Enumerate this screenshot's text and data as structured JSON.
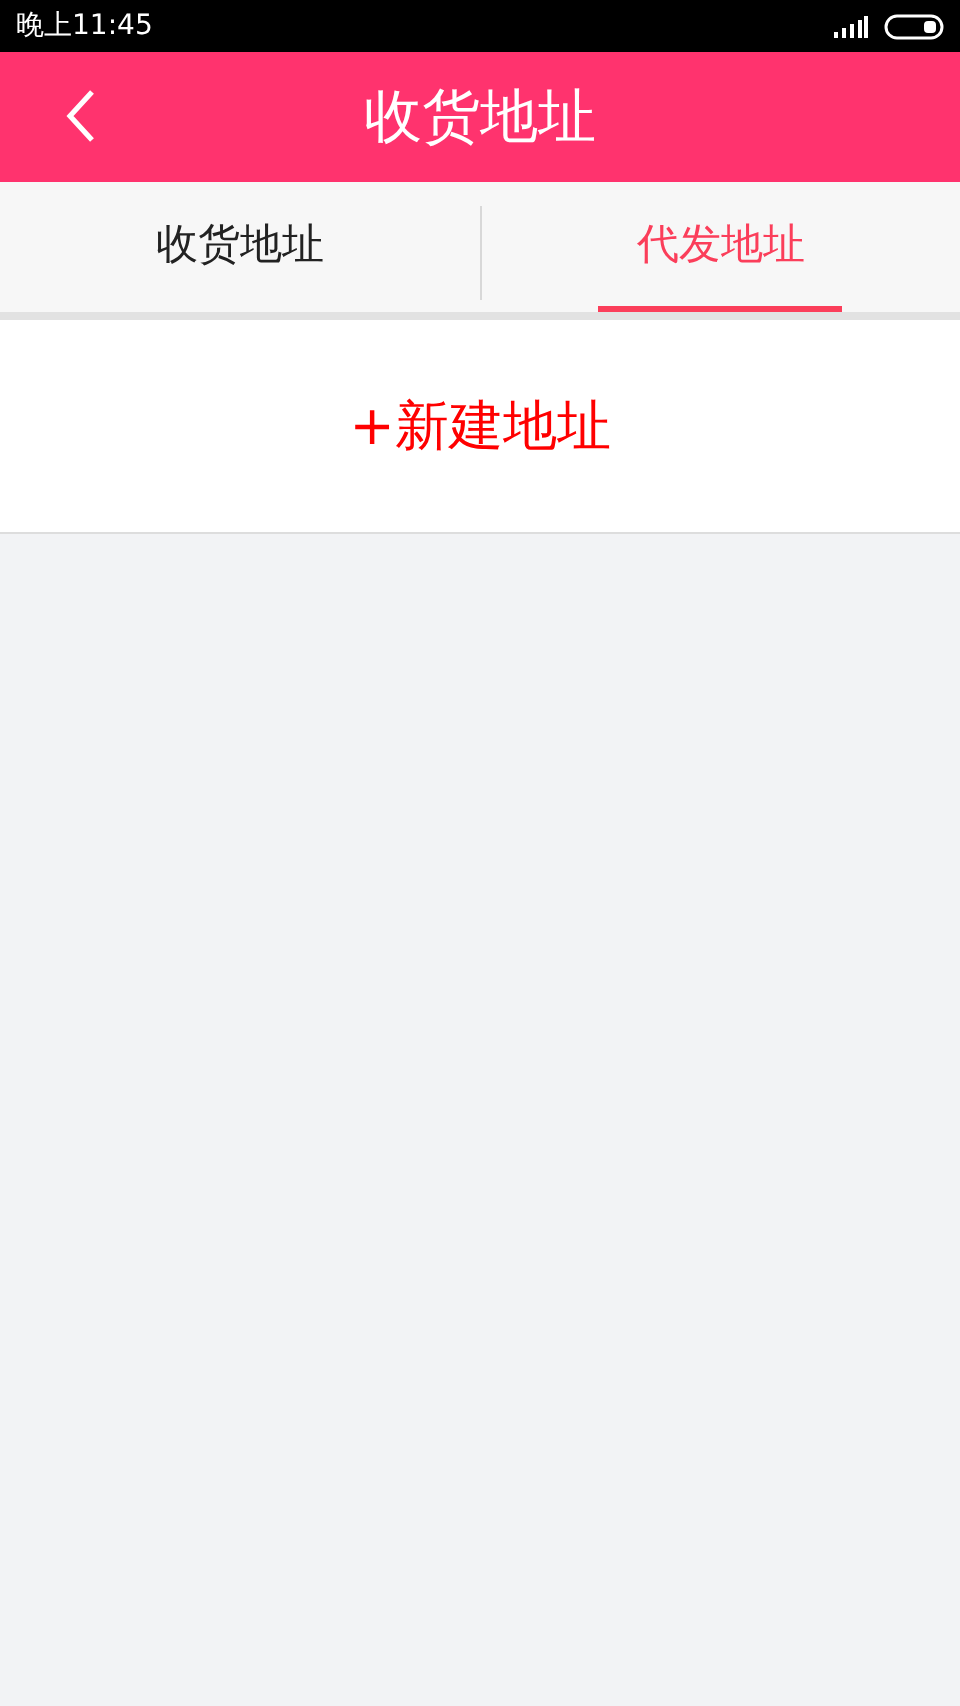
{
  "status_bar": {
    "time": "晚上11:45"
  },
  "header": {
    "title": "收货地址"
  },
  "tabs": [
    {
      "label": "收货地址",
      "selected": false
    },
    {
      "label": "代发地址",
      "selected": true
    }
  ],
  "add_button": {
    "label": "+新建地址"
  }
}
